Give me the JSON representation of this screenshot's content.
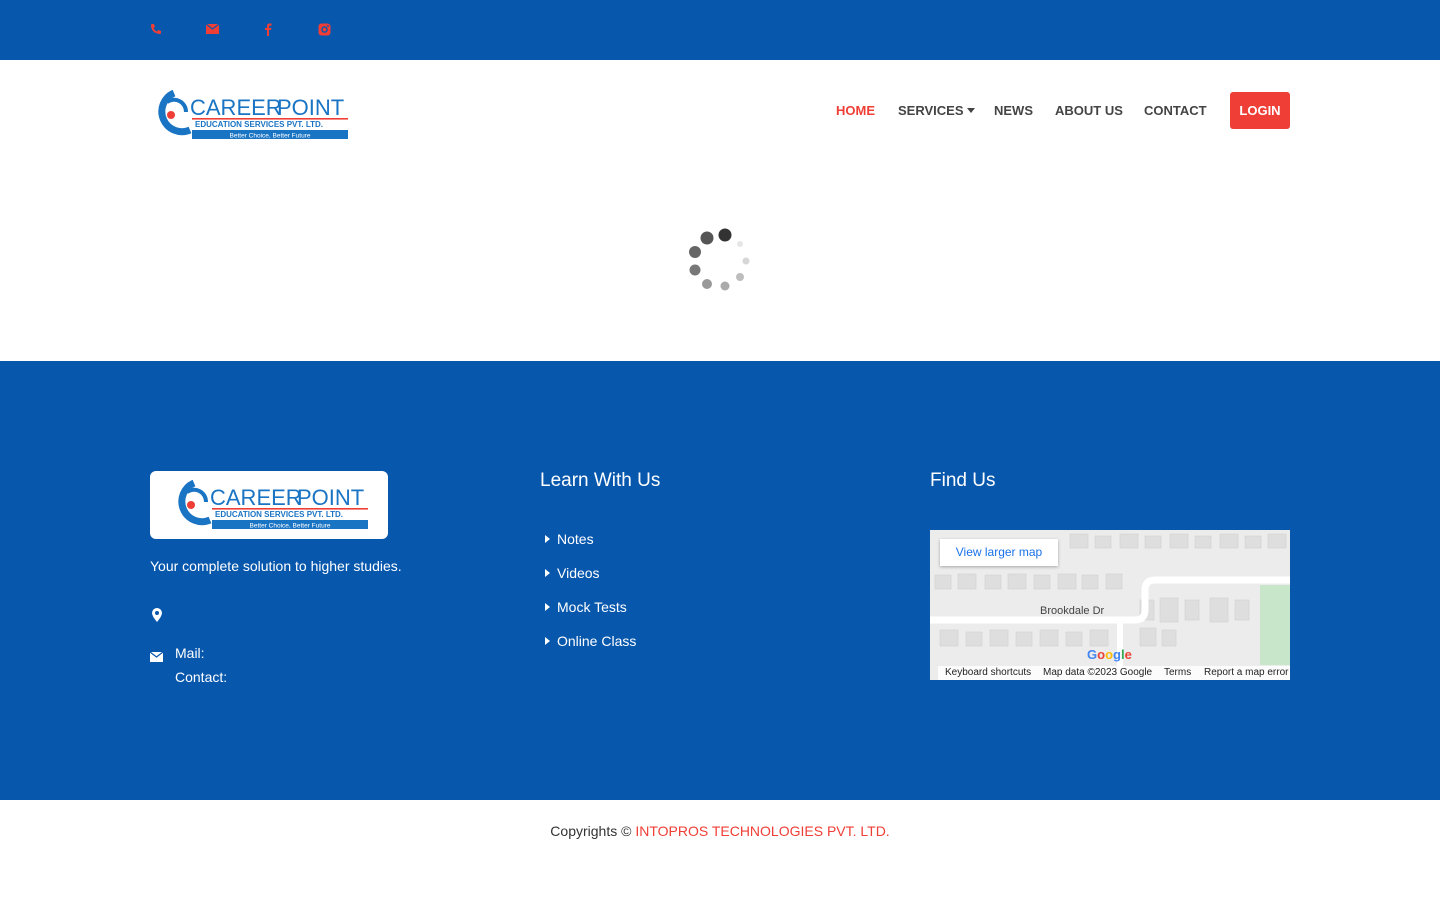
{
  "topbar": {
    "icons": [
      "phone-icon",
      "mail-icon",
      "facebook-icon",
      "instagram-icon"
    ]
  },
  "brand": {
    "logo_word1": "CAREER",
    "logo_word2": "POINT",
    "logo_sub": "EDUCATION SERVICES PVT. LTD.",
    "logo_tagline": "Better Choice, Better Future",
    "primary_color": "#0757ad",
    "accent_color": "#ef3e36"
  },
  "nav": {
    "home": "HOME",
    "services": "SERVICES",
    "news": "NEWS",
    "about": "ABOUT US",
    "contact": "CONTACT",
    "login": "LOGIN"
  },
  "footer": {
    "tagline": "Your complete solution to higher studies.",
    "mail_label": "Mail:",
    "contact_label": "Contact:",
    "learn_heading": "Learn With Us",
    "learn_items": [
      "Notes",
      "Videos",
      "Mock Tests",
      "Online Class"
    ],
    "find_heading": "Find Us",
    "map": {
      "view_larger": "View larger map",
      "road": "Brookdale Dr",
      "keyboard": "Keyboard shortcuts",
      "map_data": "Map data ©2023 Google",
      "terms": "Terms",
      "report": "Report a map error"
    }
  },
  "copyright": {
    "prefix": "Copyrights © ",
    "company": "INTOPROS TECHNOLOGIES PVT. LTD."
  }
}
